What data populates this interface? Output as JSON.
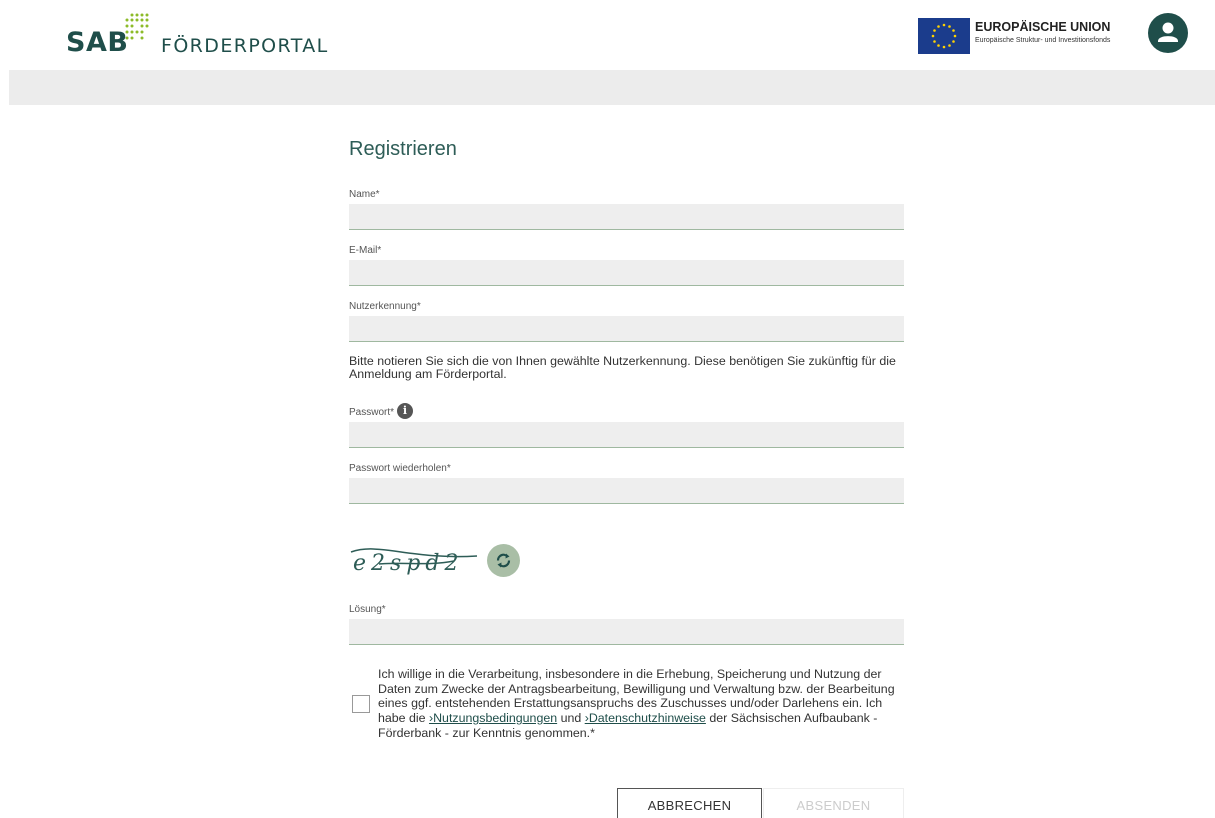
{
  "header": {
    "logo_sab": "SAB",
    "logo_portal": "FÖRDERPORTAL",
    "eu_title": "EUROPÄISCHE UNION",
    "eu_subtitle": "Europäische Struktur- und Investitionsfonds"
  },
  "form": {
    "title": "Registrieren",
    "name_label": "Name*",
    "email_label": "E-Mail*",
    "username_label": "Nutzerkennung*",
    "username_hint": "Bitte notieren Sie sich die von Ihnen gewählte Nutzerkennung. Diese benötigen Sie zukünftig für die Anmeldung am Förderportal.",
    "password_label": "Passwort*",
    "password_info_glyph": "i",
    "password_repeat_label": "Passwort wiederholen*",
    "captcha_text": "e2spd2",
    "solution_label": "Lösung*",
    "consent_text_1": "Ich willige in die Verarbeitung, insbesondere in die Erhebung, Speicherung und Nutzung der Daten zum Zwecke der Antragsbearbeitung, Bewilligung und Verwaltung bzw. der Bearbeitung eines ggf. entstehenden Erstattungsanspruchs des Zuschusses und/oder Darlehens ein. Ich habe die ",
    "consent_link_terms": "›Nutzungsbedingungen",
    "consent_text_2": " und ",
    "consent_link_privacy": "›Datenschutzhinweise",
    "consent_text_3": " der Sächsischen Aufbaubank - Förderbank - zur Kenntnis genommen.*",
    "cancel_label": "ABBRECHEN",
    "submit_label": "ABSENDEN"
  },
  "colors": {
    "brand": "#1f4e4a",
    "accent_green": "#a9bea6",
    "eu_blue": "#1b3c8c",
    "eu_star": "#ffd200"
  }
}
